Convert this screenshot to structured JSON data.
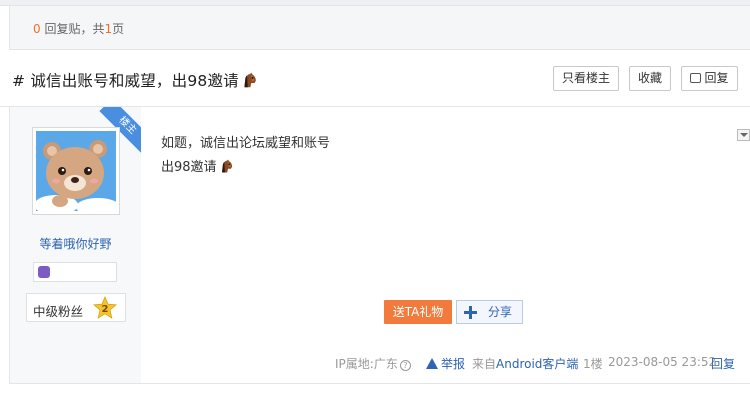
{
  "reply_bar": {
    "count": "0",
    "text_after_count": " 回复贴，共",
    "pages": "1",
    "text_after_pages": "页"
  },
  "thread": {
    "title": "# 诚信出账号和威望，出98邀请",
    "emoji_icon": "horse-face-emoji-icon",
    "buttons": {
      "only_op": "只看楼主",
      "collect": "收藏",
      "reply": "回复"
    }
  },
  "post": {
    "ribbon": "楼主",
    "author": {
      "name": "等着哦你好野",
      "level_title": "中级粉丝",
      "level": "2"
    },
    "content_lines": [
      "如题，诚信出论坛威望和账号",
      "出98邀请"
    ],
    "actions": {
      "gift": "送TA礼物",
      "share": "分享"
    },
    "meta": {
      "ip_location": "IP属地:广东",
      "help": "?",
      "report": "举报",
      "source": "来自Android客户端",
      "floor": "1楼",
      "datetime": "2023-08-05 23:52",
      "reply": "回复"
    }
  },
  "colors": {
    "accent_orange": "#f27a3c",
    "link_blue": "#2d64b3",
    "ribbon_blue": "#4a8ee0"
  }
}
